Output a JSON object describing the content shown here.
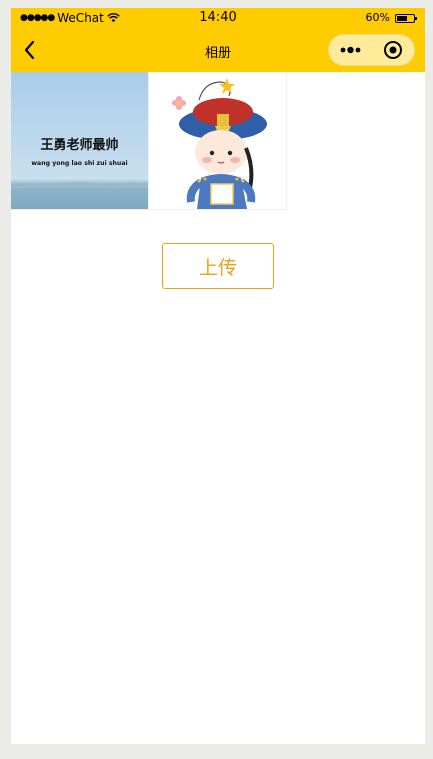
{
  "status_bar": {
    "signal": "●●●●●",
    "carrier": "WeChat",
    "time": "14:40",
    "battery_text": "60%",
    "battery_level": 0.6
  },
  "nav": {
    "title": "相册",
    "bg_color": "#ffcc00"
  },
  "gallery": {
    "photos": [
      {
        "caption_cn": "王勇老师最帅",
        "caption_pinyin": "wang yong lao shi zui shuai"
      },
      {
        "caption_cn": "",
        "caption_pinyin": ""
      }
    ]
  },
  "upload": {
    "label": "上传",
    "color": "#f0a015"
  },
  "icons": {
    "back": "chevron-left-icon",
    "more": "more-dots-icon",
    "close": "target-circle-icon",
    "wifi": "wifi-icon",
    "battery": "battery-icon"
  }
}
